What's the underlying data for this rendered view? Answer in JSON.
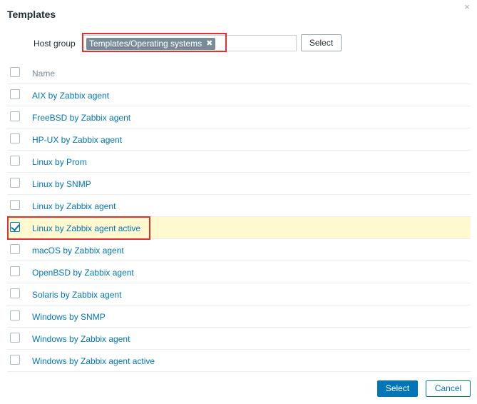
{
  "dialog": {
    "title": "Templates",
    "close_icon": "close-icon",
    "close_glyph": "×"
  },
  "filter": {
    "label": "Host group",
    "chip_label": "Templates/Operating systems",
    "chip_remove_glyph": "✖",
    "select_label": "Select"
  },
  "table": {
    "header_name": "Name",
    "rows": [
      {
        "name": "AIX by Zabbix agent",
        "checked": false
      },
      {
        "name": "FreeBSD by Zabbix agent",
        "checked": false
      },
      {
        "name": "HP-UX by Zabbix agent",
        "checked": false
      },
      {
        "name": "Linux by Prom",
        "checked": false
      },
      {
        "name": "Linux by SNMP",
        "checked": false
      },
      {
        "name": "Linux by Zabbix agent",
        "checked": false
      },
      {
        "name": "Linux by Zabbix agent active",
        "checked": true
      },
      {
        "name": "macOS by Zabbix agent",
        "checked": false
      },
      {
        "name": "OpenBSD by Zabbix agent",
        "checked": false
      },
      {
        "name": "Solaris by Zabbix agent",
        "checked": false
      },
      {
        "name": "Windows by SNMP",
        "checked": false
      },
      {
        "name": "Windows by Zabbix agent",
        "checked": false
      },
      {
        "name": "Windows by Zabbix agent active",
        "checked": false
      }
    ]
  },
  "footer": {
    "select_label": "Select",
    "cancel_label": "Cancel"
  },
  "colors": {
    "accent": "#0275b8",
    "highlight_row": "#fef9cf",
    "annotation_red": "#e0312f",
    "chip_bg": "#768d99"
  }
}
